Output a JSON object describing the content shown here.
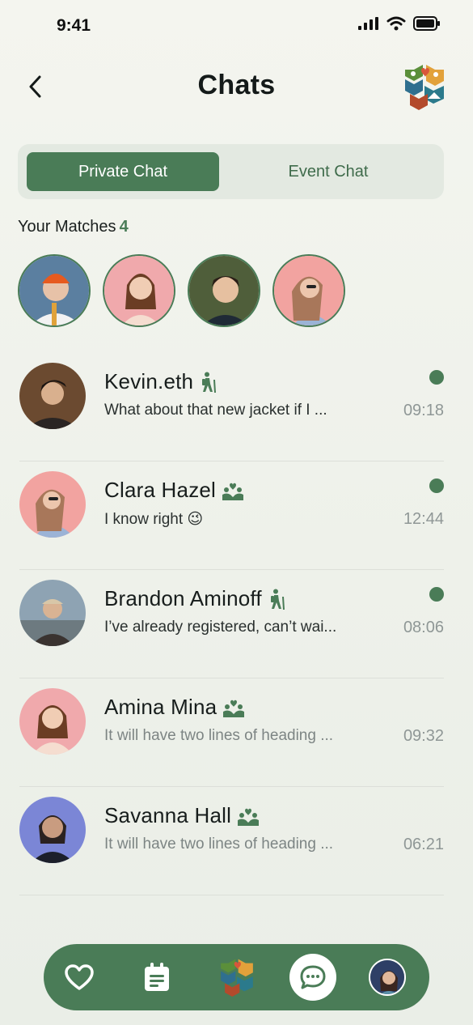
{
  "status_bar": {
    "time": "9:41"
  },
  "header": {
    "title": "Chats",
    "back_icon": "chevron-left-icon",
    "logo_icon": "app-logo-hexagon-icon"
  },
  "tabs": [
    {
      "label": "Private Chat",
      "active": true
    },
    {
      "label": "Event Chat",
      "active": false
    }
  ],
  "matches": {
    "label": "Your Matches",
    "count": "4"
  },
  "chats": [
    {
      "name": "Kevin.eth",
      "activity_icon": "hiking-icon",
      "message": "What about that new jacket if I ...",
      "time": "09:18",
      "online": true
    },
    {
      "name": "Clara Hazel",
      "activity_icon": "volunteer-icon",
      "message": "I know right 😉",
      "time": "12:44",
      "online": true
    },
    {
      "name": "Brandon Aminoff",
      "activity_icon": "hiking-icon",
      "message": "I’ve already registered, can’t wai...",
      "time": "08:06",
      "online": true
    },
    {
      "name": "Amina Mina",
      "activity_icon": "volunteer-icon",
      "message": "It will have two lines of heading ...",
      "time": "09:32",
      "online": false
    },
    {
      "name": "Savanna Hall",
      "activity_icon": "volunteer-icon",
      "message": "It will have two lines of heading ...",
      "time": "06:21",
      "online": false
    }
  ],
  "nav": [
    "heart-icon",
    "calendar-note-icon",
    "app-logo-hexagon-icon",
    "chat-bubble-icon",
    "profile-avatar"
  ],
  "colors": {
    "accent": "#4a7c57",
    "segment_bg": "#e3e9e1",
    "background": "#f4f5ef"
  }
}
